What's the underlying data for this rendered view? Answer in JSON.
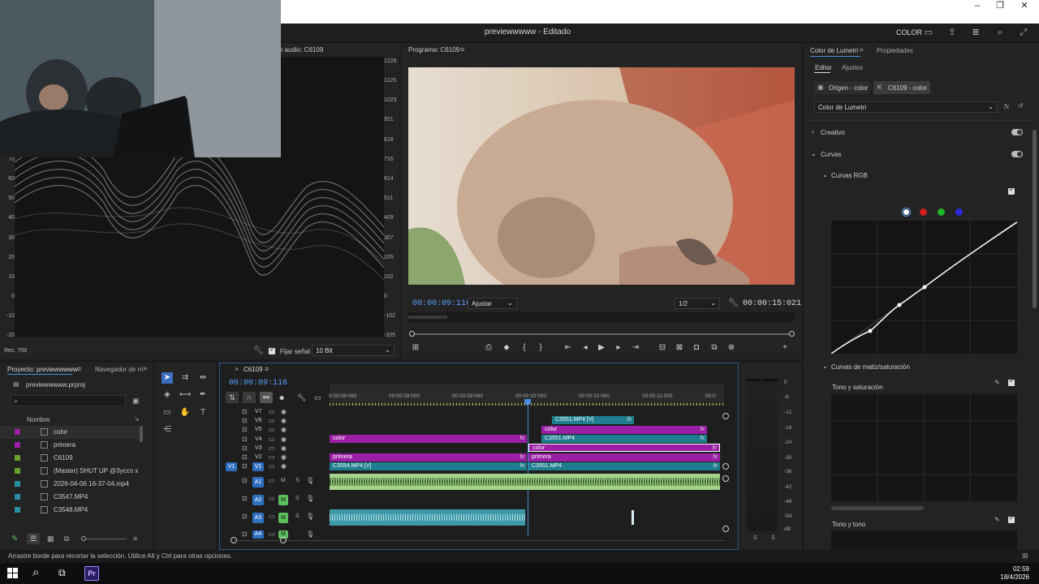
{
  "window": {
    "title": "previewwwww - Editado",
    "workspace": "COLOR",
    "controls": [
      "–",
      "❐",
      "✕"
    ]
  },
  "scopes": {
    "header": "e audio: C6109",
    "left_ticks": [
      "70",
      "60",
      "50",
      "40",
      "30",
      "20",
      "10",
      "0",
      "-10",
      "-20"
    ],
    "right_ticks": [
      "1228",
      "1125",
      "1023",
      "921",
      "818",
      "716",
      "614",
      "511",
      "409",
      "307",
      "205",
      "102",
      "0",
      "-102",
      "-205"
    ],
    "footer_label": "Rec. 709",
    "clamp_label": "Fijar señal",
    "bit_depth": "10 Bit"
  },
  "program": {
    "title": "Programa: C6109",
    "timecode": "00:00:09:116",
    "fit": "Ajustar",
    "resolution": "1/2",
    "duration": "00:00:15:021",
    "playhead_fraction": 0.1
  },
  "lumetri": {
    "tabs": [
      "Color de Lumetri",
      "Propiedades"
    ],
    "subtabs": [
      "Editar",
      "Ajustes"
    ],
    "source_chip": "Origen - color",
    "target_chip": "C6109 - color",
    "effect_select": "Color de Lumetri",
    "sections": [
      "Creativo",
      "Curvas"
    ],
    "curves_rgb": "Curvas RGB",
    "hue_sat_curves": "Curvas de matiz/saturación",
    "hue_sat_label": "Tono y saturación",
    "hue_hue_label": "Tono y tono",
    "channel_colors": [
      "#ffffff",
      "#d11f1f",
      "#1fb52a",
      "#2a2ad8"
    ]
  },
  "project": {
    "tabs": [
      "Proyecto: previewwwww",
      "Navegador de m"
    ],
    "file": "previewwwww.prproj",
    "search_placeholder": "",
    "col_name": "Nombre",
    "items": [
      {
        "name": "color",
        "swatch": "#9b1fa6"
      },
      {
        "name": "primera",
        "swatch": "#9b1fa6"
      },
      {
        "name": "C6109",
        "swatch": "#6aa32a"
      },
      {
        "name": "(Master) SHUT UP @3ycco x",
        "swatch": "#6aa32a"
      },
      {
        "name": "2026-04-06 16-37-04.mp4",
        "swatch": "#2a8ea3"
      },
      {
        "name": "C3547.MP4",
        "swatch": "#2a8ea3"
      },
      {
        "name": "C3548.MP4",
        "swatch": "#2a8ea3"
      }
    ]
  },
  "timeline": {
    "tab": "C6109",
    "timecode": "00:00:09:116",
    "ruler": [
      "0:00:08:060",
      "00:00:09:000",
      "00:00:09:060",
      "00:00:10:000",
      "00:00:10:060",
      "00:00:11:000",
      "00:0"
    ],
    "video_tracks": [
      "V7",
      "V6",
      "V5",
      "V4",
      "V3",
      "V2",
      "V1"
    ],
    "audio_tracks": [
      "A1",
      "A2",
      "A3",
      "A4"
    ],
    "source_patch": "V1",
    "clips": {
      "v7": "C3551.MP4 [V]",
      "v5": "color",
      "v4a": "color",
      "v4b": "C3551.MP4",
      "v3": "color",
      "v2a": "primera",
      "v2b": "primera",
      "v1a": "C3554.MP4 [V]",
      "v1b": "C3551.MP4",
      "fx": "fx"
    },
    "mute": "M",
    "solo": "S"
  },
  "meters": {
    "ticks": [
      "0",
      "-6",
      "-12",
      "-18",
      "-24",
      "-30",
      "-36",
      "-42",
      "-48",
      "-54",
      "dB"
    ],
    "solo": [
      "S",
      "S"
    ]
  },
  "status": {
    "text": "Arrastre borde para recortar la selección. Utilice Alt y Ctrl para otras opciones."
  },
  "taskbar": {
    "time": "02:59",
    "date": "18/4/2026",
    "app": "Pr"
  }
}
